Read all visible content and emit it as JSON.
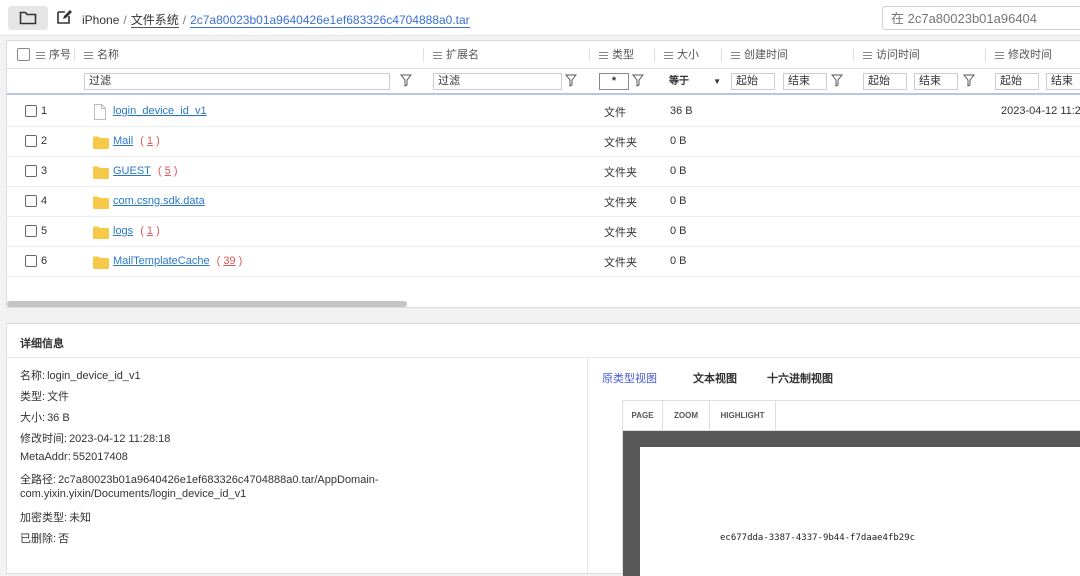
{
  "toolbar": {
    "breadcrumb": {
      "root": "iPhone",
      "sep1": "/",
      "mid": "文件系统",
      "sep2": "/",
      "current": "2c7a80023b01a9640426e1ef683326c4704888a0.tar"
    },
    "search_placeholder": "在 2c7a80023b01a96404"
  },
  "grid": {
    "columns": {
      "index": "序号",
      "name": "名称",
      "ext": "扩展名",
      "type": "类型",
      "size": "大小",
      "created": "创建时间",
      "accessed": "访问时间",
      "modified": "修改时间"
    },
    "filters": {
      "name": "过滤",
      "ext": "过滤",
      "type": "*",
      "size_op": "等于",
      "created_start": "起始",
      "created_end": "结束",
      "accessed_start": "起始",
      "accessed_end": "结束",
      "modified_start": "起始",
      "modified_end": "结束"
    },
    "rows": [
      {
        "index": "1",
        "name": "login_device_id_v1",
        "count": "",
        "type": "文件",
        "size": "36 B",
        "modified": "2023-04-12 11:2",
        "kind": "file"
      },
      {
        "index": "2",
        "name": "Mail",
        "count": "1",
        "type": "文件夹",
        "size": "0 B",
        "modified": "",
        "kind": "folder"
      },
      {
        "index": "3",
        "name": "GUEST",
        "count": "5",
        "type": "文件夹",
        "size": "0 B",
        "modified": "",
        "kind": "folder"
      },
      {
        "index": "4",
        "name": "com.csng.sdk.data",
        "count": "",
        "type": "文件夹",
        "size": "0 B",
        "modified": "",
        "kind": "folder"
      },
      {
        "index": "5",
        "name": "logs",
        "count": "1",
        "type": "文件夹",
        "size": "0 B",
        "modified": "",
        "kind": "folder"
      },
      {
        "index": "6",
        "name": "MailTemplateCache",
        "count": "39",
        "type": "文件夹",
        "size": "0 B",
        "modified": "",
        "kind": "folder"
      }
    ]
  },
  "details": {
    "title": "详细信息",
    "fields": [
      {
        "k": "名称:",
        "v": "login_device_id_v1"
      },
      {
        "k": "类型:",
        "v": "文件"
      },
      {
        "k": "大小:",
        "v": "36 B"
      },
      {
        "k": "修改时间:",
        "v": "2023-04-12 11:28:18"
      },
      {
        "k": "MetaAddr:",
        "v": "552017408"
      },
      {
        "k": "全路径:",
        "v": "2c7a80023b01a9640426e1ef683326c4704888a0.tar/AppDomain-"
      },
      {
        "k": "",
        "v": "com.yixin.yixin/Documents/login_device_id_v1"
      },
      {
        "k": "加密类型:",
        "v": "未知"
      },
      {
        "k": "已删除:",
        "v": "否"
      }
    ],
    "tabs": {
      "raw": "原类型视图",
      "text": "文本视图",
      "hex": "十六进制视图"
    },
    "viewer": {
      "page": "PAGE",
      "zoom": "ZOOM",
      "highlight": "HIGHLIGHT",
      "content": "ec677dda-3387-4337-9b44-f7daae4fb29c"
    }
  },
  "colors": {
    "link": "#2a78c8",
    "count": "#e25555",
    "active_tab": "#4a5ad8",
    "folder": "#f7c948"
  }
}
